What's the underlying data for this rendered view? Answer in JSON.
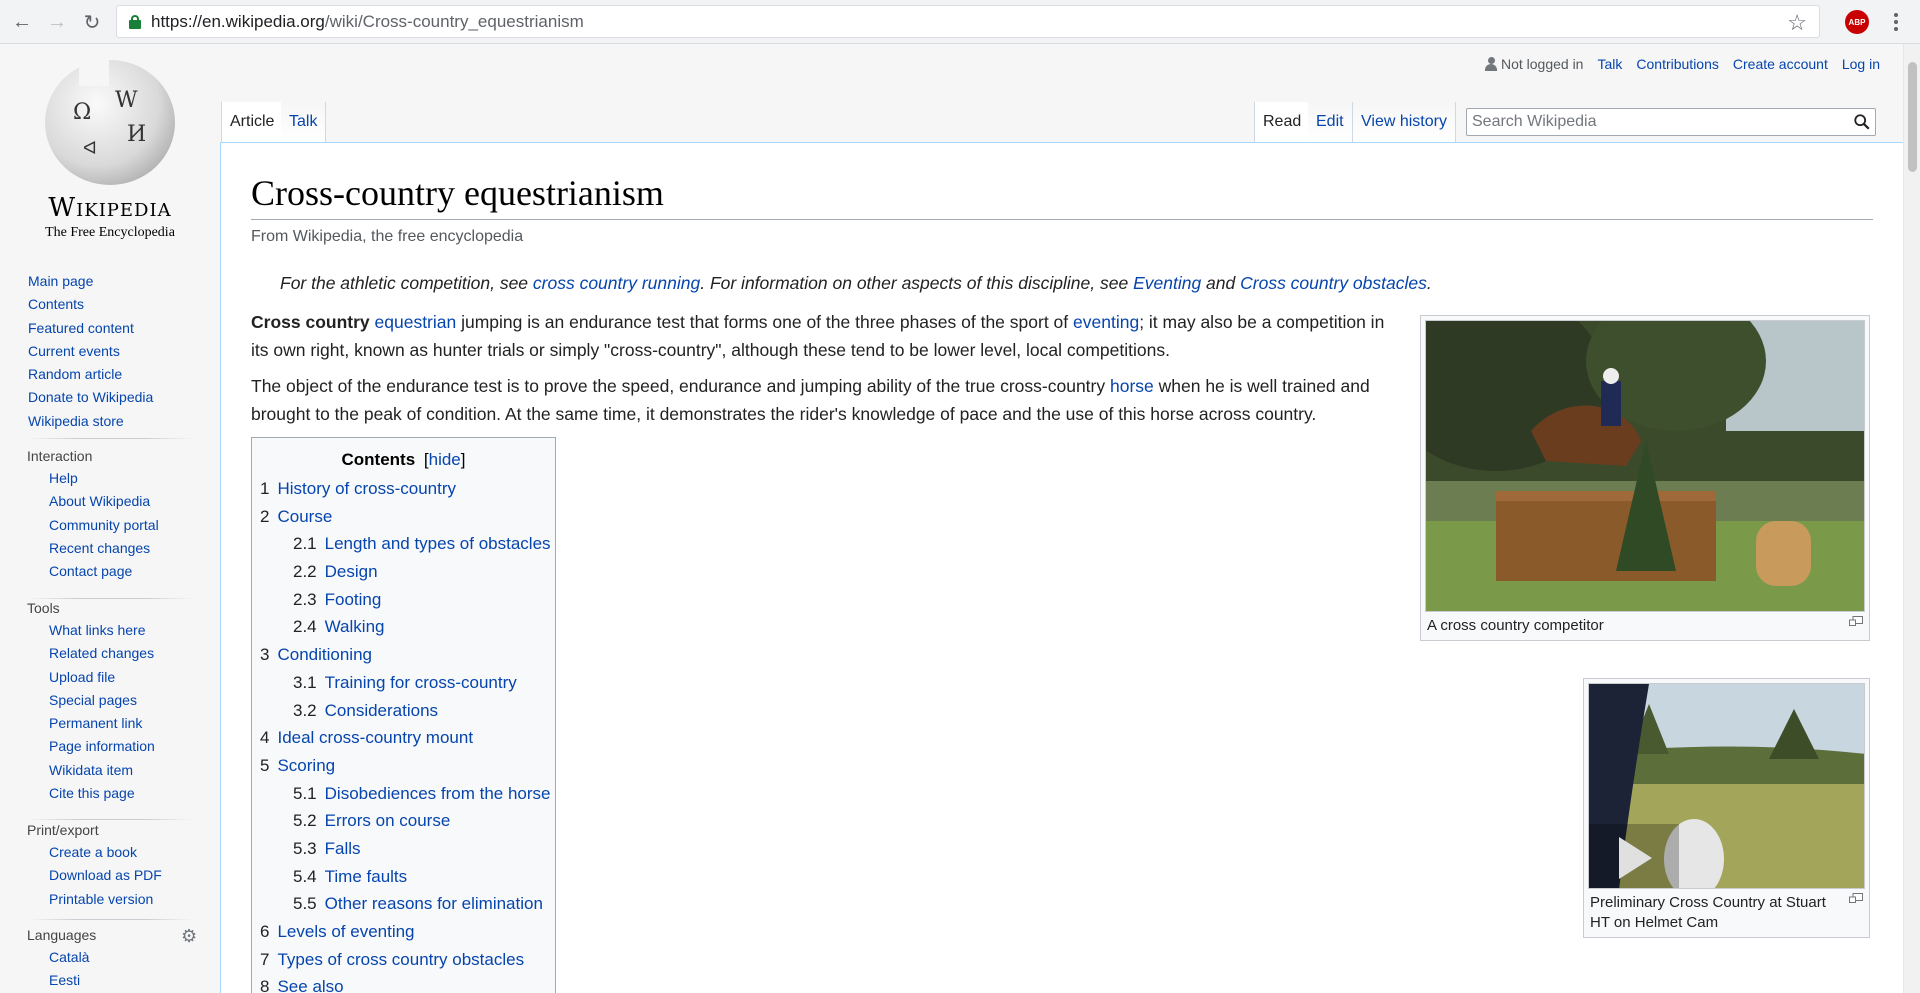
{
  "browser": {
    "url_host": "https://en.wikipedia.org",
    "url_path": "/wiki/Cross-country_equestrianism",
    "abp_label": "ABP"
  },
  "logo": {
    "wordmark": "Wikipedia",
    "tagline": "The Free Encyclopedia"
  },
  "navigation": [
    "Main page",
    "Contents",
    "Featured content",
    "Current events",
    "Random article",
    "Donate to Wikipedia",
    "Wikipedia store"
  ],
  "interaction": {
    "heading": "Interaction",
    "items": [
      "Help",
      "About Wikipedia",
      "Community portal",
      "Recent changes",
      "Contact page"
    ]
  },
  "tools": {
    "heading": "Tools",
    "items": [
      "What links here",
      "Related changes",
      "Upload file",
      "Special pages",
      "Permanent link",
      "Page information",
      "Wikidata item",
      "Cite this page"
    ]
  },
  "print": {
    "heading": "Print/export",
    "items": [
      "Create a book",
      "Download as PDF",
      "Printable version"
    ]
  },
  "languages": {
    "heading": "Languages",
    "items": [
      "Català",
      "Eesti"
    ]
  },
  "personal": {
    "not_logged_in": "Not logged in",
    "talk": "Talk",
    "contributions": "Contributions",
    "create_account": "Create account",
    "log_in": "Log in"
  },
  "tabs": {
    "article": "Article",
    "talk": "Talk",
    "read": "Read",
    "edit": "Edit",
    "view_history": "View history"
  },
  "search": {
    "placeholder": "Search Wikipedia"
  },
  "article": {
    "title": "Cross-country equestrianism",
    "site_sub": "From Wikipedia, the free encyclopedia",
    "hatnote": {
      "t1": "For the athletic competition, see ",
      "l1": "cross country running",
      "t2": ". For information on other aspects of this discipline, see ",
      "l2": "Eventing",
      "t3": " and ",
      "l3": "Cross country obstacles",
      "t4": "."
    },
    "p1": {
      "bold": "Cross country",
      "l1": "equestrian",
      "t1": " jumping is an endurance test that forms one of the three phases of the sport of ",
      "l2": "eventing",
      "t2": "; it may also be a competition in its own right, known as hunter trials or simply \"cross-country\", although these tend to be lower level, local competitions."
    },
    "p2": {
      "t1": "The object of the endurance test is to prove the speed, endurance and jumping ability of the true cross-country ",
      "l1": "horse",
      "t2": " when he is well trained and brought to the peak of condition. At the same time, it demonstrates the rider's knowledge of pace and the use of this horse across country."
    }
  },
  "toc": {
    "title": "Contents",
    "hide": "hide",
    "items": [
      {
        "num": "1",
        "label": "History of cross-country"
      },
      {
        "num": "2",
        "label": "Course"
      },
      {
        "num": "2.1",
        "label": "Length and types of obstacles"
      },
      {
        "num": "2.2",
        "label": "Design"
      },
      {
        "num": "2.3",
        "label": "Footing"
      },
      {
        "num": "2.4",
        "label": "Walking"
      },
      {
        "num": "3",
        "label": "Conditioning"
      },
      {
        "num": "3.1",
        "label": "Training for cross-country"
      },
      {
        "num": "3.2",
        "label": "Considerations"
      },
      {
        "num": "4",
        "label": "Ideal cross-country mount"
      },
      {
        "num": "5",
        "label": "Scoring"
      },
      {
        "num": "5.1",
        "label": "Disobediences from the horse"
      },
      {
        "num": "5.2",
        "label": "Errors on course"
      },
      {
        "num": "5.3",
        "label": "Falls"
      },
      {
        "num": "5.4",
        "label": "Time faults"
      },
      {
        "num": "5.5",
        "label": "Other reasons for elimination"
      },
      {
        "num": "6",
        "label": "Levels of eventing"
      },
      {
        "num": "7",
        "label": "Types of cross country obstacles"
      },
      {
        "num": "8",
        "label": "See also"
      }
    ]
  },
  "figures": {
    "fig1_caption": "A cross country competitor",
    "fig2_caption": "Preliminary Cross Country at Stuart HT on Helmet Cam"
  }
}
